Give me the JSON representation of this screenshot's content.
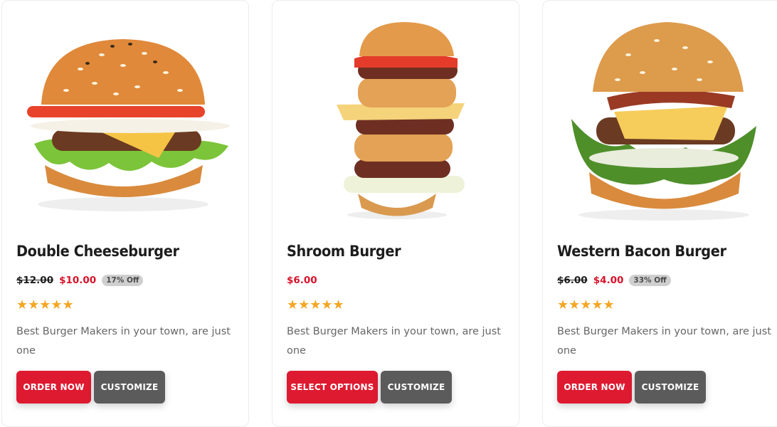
{
  "colors": {
    "accent": "#de1a31",
    "price": "#d7142b",
    "secondary_button": "#5b5b5b",
    "star": "#f5a623"
  },
  "products": [
    {
      "name": "Double Cheeseburger",
      "old_price": "$12.00",
      "price": "$10.00",
      "discount": "17% Off",
      "rating": 5,
      "stars": "★★★★★",
      "description": "Best Burger Makers in your town, are just one",
      "primary_button": "ORDER NOW",
      "secondary_button": "CUSTOMIZE"
    },
    {
      "name": "Shroom Burger",
      "old_price": "",
      "price": "$6.00",
      "discount": "",
      "rating": 5,
      "stars": "★★★★★",
      "description": "Best Burger Makers in your town, are just one",
      "primary_button": "SELECT OPTIONS",
      "secondary_button": "CUSTOMIZE"
    },
    {
      "name": "Western Bacon Burger",
      "old_price": "$6.00",
      "price": "$4.00",
      "discount": "33% Off",
      "rating": 5,
      "stars": "★★★★★",
      "description": "Best Burger Makers in your town, are just one",
      "primary_button": "ORDER NOW",
      "secondary_button": "CUSTOMIZE"
    }
  ]
}
